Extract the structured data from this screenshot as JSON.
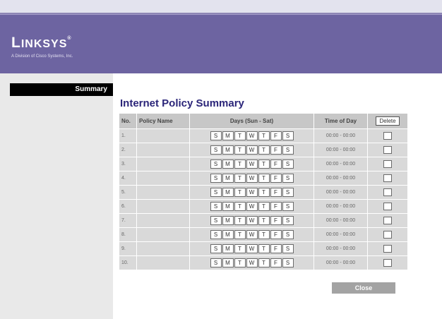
{
  "brand": {
    "logo_big1": "L",
    "logo_small": "INKSYS",
    "logo_reg": "®",
    "tagline": "A Division of Cisco Systems, Inc."
  },
  "sidebar": {
    "items": [
      {
        "label": "Summary",
        "active": true
      }
    ]
  },
  "main": {
    "title": "Internet Policy Summary",
    "columns": {
      "no": "No.",
      "policy_name": "Policy Name",
      "days": "Days (Sun - Sat)",
      "time": "Time of Day",
      "delete": "Delete"
    },
    "days": [
      "S",
      "M",
      "T",
      "W",
      "T",
      "F",
      "S"
    ],
    "rows": [
      {
        "no": "1.",
        "policy_name": "",
        "time": "00:00 - 00:00"
      },
      {
        "no": "2.",
        "policy_name": "",
        "time": "00:00 - 00:00"
      },
      {
        "no": "3.",
        "policy_name": "",
        "time": "00:00 - 00:00"
      },
      {
        "no": "4.",
        "policy_name": "",
        "time": "00:00 - 00:00"
      },
      {
        "no": "5.",
        "policy_name": "",
        "time": "00:00 - 00:00"
      },
      {
        "no": "6.",
        "policy_name": "",
        "time": "00:00 - 00:00"
      },
      {
        "no": "7.",
        "policy_name": "",
        "time": "00:00 - 00:00"
      },
      {
        "no": "8.",
        "policy_name": "",
        "time": "00:00 - 00:00"
      },
      {
        "no": "9.",
        "policy_name": "",
        "time": "00:00 - 00:00"
      },
      {
        "no": "10.",
        "policy_name": "",
        "time": "00:00 - 00:00"
      }
    ],
    "close_label": "Close"
  },
  "colors": {
    "header": "#6d64a1",
    "title": "#2b2579",
    "sidebar": "#e9e9e9",
    "active_item": "#000000"
  }
}
